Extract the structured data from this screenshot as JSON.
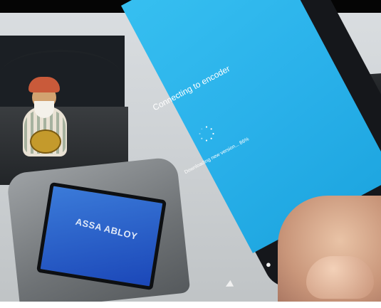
{
  "phone_screen": {
    "title": "Connecting to encoder",
    "status": "Downloading new version... 86%",
    "spinner": "loading-spinner",
    "nav_icons": [
      "back-triangle-icon",
      "home-circle-icon",
      "recents-square-icon"
    ]
  },
  "encoder_display": {
    "logo_text": "ASSA ABLOY"
  },
  "colors": {
    "screen_blue": "#2ab1ea",
    "encoder_screen_blue": "#2a5fcc",
    "phone_body": "#15171b"
  }
}
